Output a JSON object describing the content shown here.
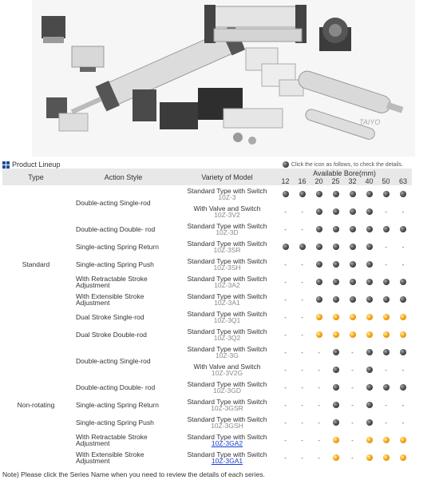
{
  "lineup_title": "Product Lineup",
  "hint": "Click the icon as follows, to check the details.",
  "header": {
    "type": "Type",
    "action": "Action Style",
    "variety": "Variety of Model",
    "bore": "Available Bore(mm)",
    "bores": [
      "12",
      "16",
      "20",
      "25",
      "32",
      "40",
      "50",
      "63"
    ]
  },
  "watermark": "TAIYO",
  "groups": [
    {
      "label": "Standard",
      "rows": [
        {
          "action": "Double-acting Single-rod",
          "subs": [
            {
              "variety": "Standard Type with Switch",
              "model": "10Z-3",
              "cells": [
                "g",
                "g",
                "g",
                "g",
                "g",
                "g",
                "g",
                "g"
              ]
            },
            {
              "variety": "With Valve and Switch",
              "model": "10Z-3V2",
              "cells": [
                "-",
                "-",
                "g",
                "g",
                "g",
                "g",
                "-",
                "-"
              ]
            }
          ]
        },
        {
          "action": "Double-acting Double- rod",
          "subs": [
            {
              "variety": "Standard Type with Switch",
              "model": "10Z-3D",
              "cells": [
                "-",
                "-",
                "g",
                "g",
                "g",
                "g",
                "g",
                "g"
              ]
            }
          ]
        },
        {
          "action": "Single-acting Spring Return",
          "subs": [
            {
              "variety": "Standard Type with Switch",
              "model": "10Z-3SR",
              "cells": [
                "g",
                "g",
                "g",
                "g",
                "g",
                "g",
                "-",
                "-"
              ]
            }
          ]
        },
        {
          "action": "Single-acting Spring Push",
          "subs": [
            {
              "variety": "Standard Type with Switch",
              "model": "10Z-3SH",
              "cells": [
                "-",
                "-",
                "g",
                "g",
                "g",
                "g",
                "-",
                "-"
              ]
            }
          ]
        },
        {
          "action": "With Retractable Stroke Adjustment",
          "subs": [
            {
              "variety": "Standard Type with Switch",
              "model": "10Z-3A2",
              "cells": [
                "-",
                "-",
                "g",
                "g",
                "g",
                "g",
                "g",
                "g"
              ]
            }
          ]
        },
        {
          "action": "With Extensible Stroke Adjustment",
          "subs": [
            {
              "variety": "Standard Type with Switch",
              "model": "10Z-3A1",
              "cells": [
                "-",
                "-",
                "g",
                "g",
                "g",
                "g",
                "g",
                "g"
              ]
            }
          ]
        },
        {
          "action": "Dual Stroke Single-rod",
          "subs": [
            {
              "variety": "Standard Type with Switch",
              "model": "10Z-3Q1",
              "cells": [
                "-",
                "-",
                "o",
                "o",
                "o",
                "o",
                "o",
                "o"
              ]
            }
          ]
        },
        {
          "action": "Dual Stroke Double-rod",
          "subs": [
            {
              "variety": "Standard Type with Switch",
              "model": "10Z-3Q2",
              "cells": [
                "-",
                "-",
                "o",
                "o",
                "o",
                "o",
                "o",
                "o"
              ]
            }
          ]
        }
      ]
    },
    {
      "label": "Non-rotating",
      "rows": [
        {
          "action": "Double-acting Single-rod",
          "subs": [
            {
              "variety": "Standard Type with Switch",
              "model": "10Z-3G",
              "cells": [
                "-",
                "-",
                "-",
                "g",
                "-",
                "g",
                "g",
                "g"
              ]
            },
            {
              "variety": "With Valve and Switch",
              "model": "10Z-3V2G",
              "cells": [
                "-",
                "-",
                "-",
                "g",
                "-",
                "g",
                "-",
                "-"
              ]
            }
          ]
        },
        {
          "action": "Double-acting Double- rod",
          "subs": [
            {
              "variety": "Standard Type with Switch",
              "model": "10Z-3GD",
              "cells": [
                "-",
                "-",
                "-",
                "g",
                "-",
                "g",
                "g",
                "g"
              ]
            }
          ]
        },
        {
          "action": "Single-acting Spring Return",
          "subs": [
            {
              "variety": "Standard Type with Switch",
              "model": "10Z-3GSR",
              "cells": [
                "-",
                "-",
                "-",
                "g",
                "-",
                "g",
                "-",
                "-"
              ]
            }
          ]
        },
        {
          "action": "Single-acting Spring Push",
          "subs": [
            {
              "variety": "Standard Type with Switch",
              "model": "10Z-3GSH",
              "cells": [
                "-",
                "-",
                "-",
                "g",
                "-",
                "g",
                "-",
                "-"
              ]
            }
          ]
        },
        {
          "action": "With Retractable Stroke Adjustment",
          "subs": [
            {
              "variety": "Standard Type with Switch",
              "model": "10Z-3GA2",
              "link": true,
              "cells": [
                "-",
                "-",
                "-",
                "o",
                "-",
                "o",
                "o",
                "o"
              ]
            }
          ]
        },
        {
          "action": "With Extensible Stroke Adjustment",
          "subs": [
            {
              "variety": "Standard Type with Switch",
              "model": "10Z-3GA1",
              "link": true,
              "cells": [
                "-",
                "-",
                "-",
                "o",
                "-",
                "o",
                "o",
                "o"
              ]
            }
          ]
        }
      ]
    }
  ],
  "note": "Note) Please click the Series Name when you need to review the details of each series."
}
